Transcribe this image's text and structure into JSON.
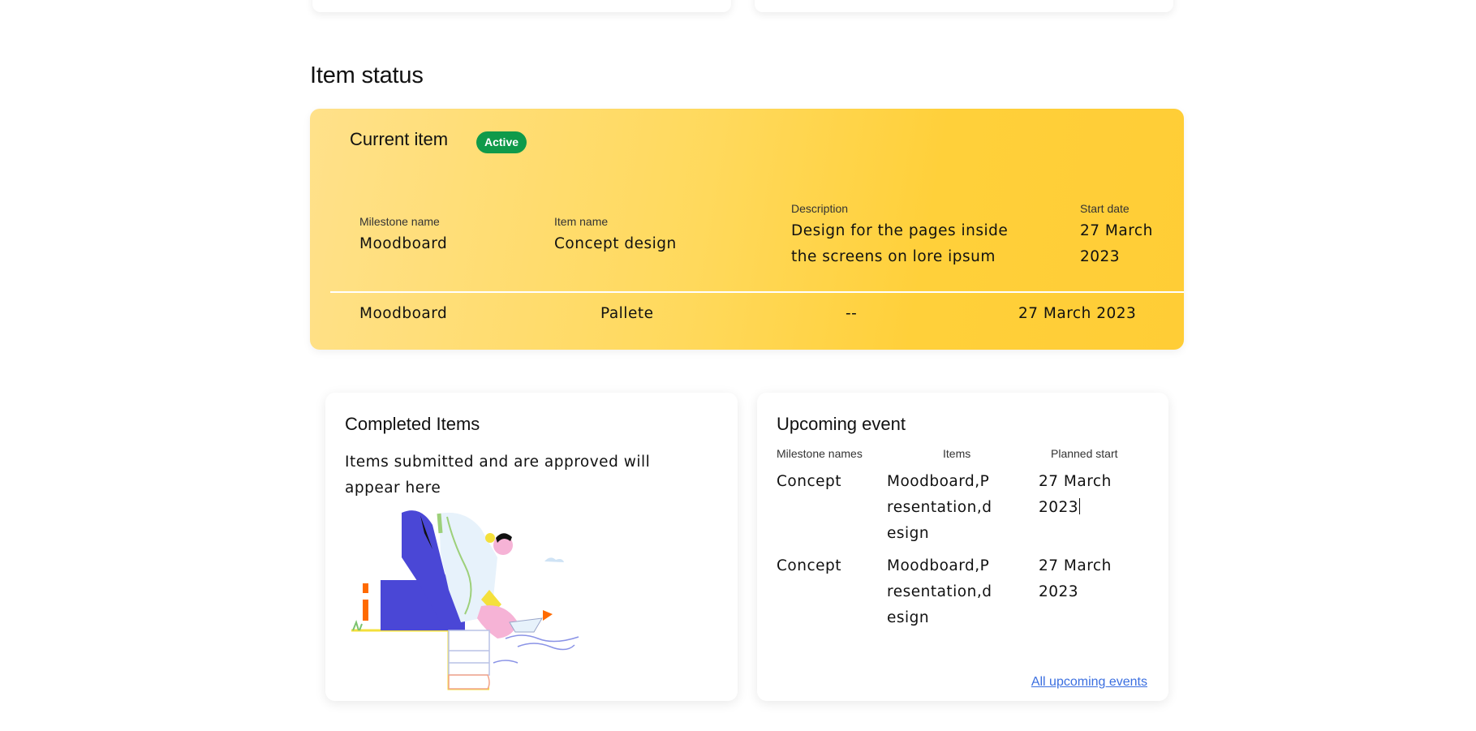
{
  "section": {
    "title": "Item status"
  },
  "current_item": {
    "title": "Current item",
    "badge": "Active",
    "labels": {
      "milestone": "Milestone name",
      "item": "Item name",
      "description": "Description",
      "start": "Start date"
    },
    "values": {
      "milestone": "Moodboard",
      "item": "Concept design",
      "description": "Design for the pages inside the screens on lore ipsum",
      "start": "27 March 2023"
    },
    "row": {
      "milestone": "Moodboard",
      "item": "Pallete",
      "description": "--",
      "start": "27 March 2023"
    }
  },
  "completed": {
    "title": "Completed Items",
    "text": "Items submitted and are approved will appear here",
    "illustration_icon": "person-placing-paper-boat-illustration"
  },
  "upcoming": {
    "title": "Upcoming event",
    "headers": {
      "milestone": "Milestone names",
      "items": "Items",
      "start": "Planned start"
    },
    "rows": [
      {
        "milestone": "Concept",
        "items": "Moodboard,Presentation,design",
        "start": "27 March 2023"
      },
      {
        "milestone": "Concept",
        "items": "Moodboard,Presentation,design",
        "start": "27 March 2023"
      }
    ],
    "link": "All upcoming events"
  },
  "colors": {
    "card_yellow": "#ffd03a",
    "badge_green": "#0f9a4a",
    "link_blue": "#3b6fe0"
  }
}
